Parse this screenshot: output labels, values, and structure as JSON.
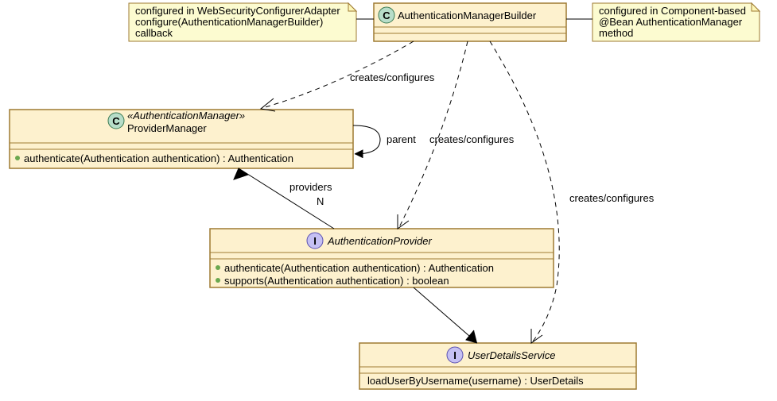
{
  "noteLeft": {
    "line1": "configured in WebSecurityConfigurerAdapter",
    "line2": "  configure(AuthenticationManagerBuilder)",
    "line3": "callback"
  },
  "noteRight": {
    "line1": "configured in Component-based",
    "line2": "  @Bean AuthenticationManager",
    "line3": "method"
  },
  "amb": {
    "letter": "C",
    "name": "AuthenticationManagerBuilder"
  },
  "pm": {
    "letter": "C",
    "stereo": "«AuthenticationManager»",
    "name": "ProviderManager",
    "m1": "authenticate(Authentication authentication) : Authentication"
  },
  "ap": {
    "letter": "I",
    "name": "AuthenticationProvider",
    "m1": "authenticate(Authentication authentication) : Authentication",
    "m2": "supports(Authentication authentication) : boolean"
  },
  "uds": {
    "letter": "I",
    "name": "UserDetailsService",
    "m1": "loadUserByUsername(username) : UserDetails"
  },
  "edges": {
    "amb_pm": "creates/configures",
    "amb_ap": "creates/configures",
    "amb_uds": "creates/configures",
    "pm_self": "parent",
    "pm_ap_label": "providers",
    "pm_ap_mult": "N"
  }
}
